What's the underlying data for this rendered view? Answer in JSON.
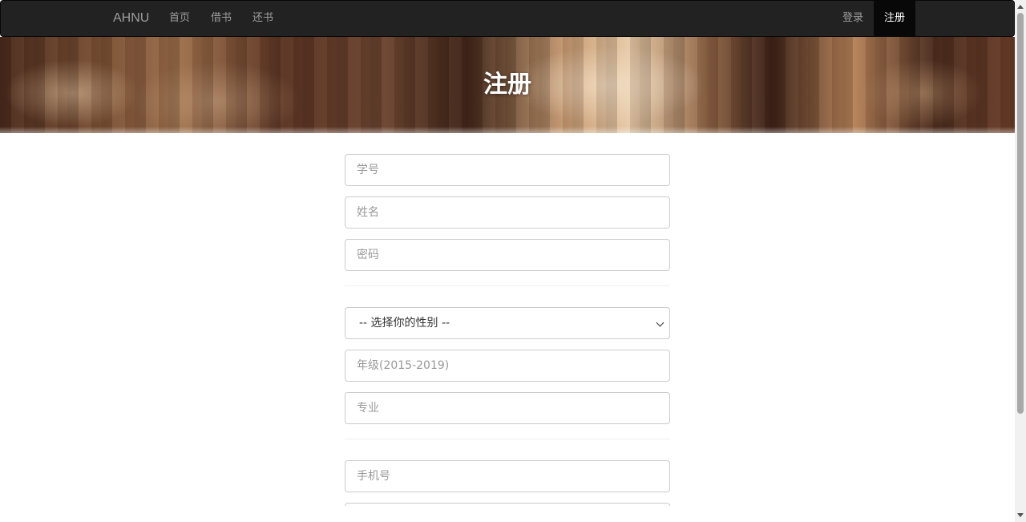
{
  "navbar": {
    "brand": "AHNU",
    "left_items": [
      {
        "label": "首页"
      },
      {
        "label": "借书"
      },
      {
        "label": "还书"
      }
    ],
    "right_items": [
      {
        "label": "登录"
      },
      {
        "label": "注册",
        "active": true
      }
    ]
  },
  "banner": {
    "title": "注册"
  },
  "form": {
    "student_id": {
      "placeholder": "学号",
      "value": ""
    },
    "name": {
      "placeholder": "姓名",
      "value": ""
    },
    "password": {
      "placeholder": "密码",
      "value": ""
    },
    "gender": {
      "selected": "-- 选择你的性别 --"
    },
    "grade": {
      "placeholder": "年级(2015-2019)",
      "value": ""
    },
    "major": {
      "placeholder": "专业",
      "value": ""
    },
    "phone": {
      "placeholder": "手机号",
      "value": ""
    }
  },
  "colors": {
    "navbar_bg": "#222222",
    "nav_text": "#9d9d9d",
    "nav_active_bg": "#080808",
    "input_border": "#cccccc"
  }
}
